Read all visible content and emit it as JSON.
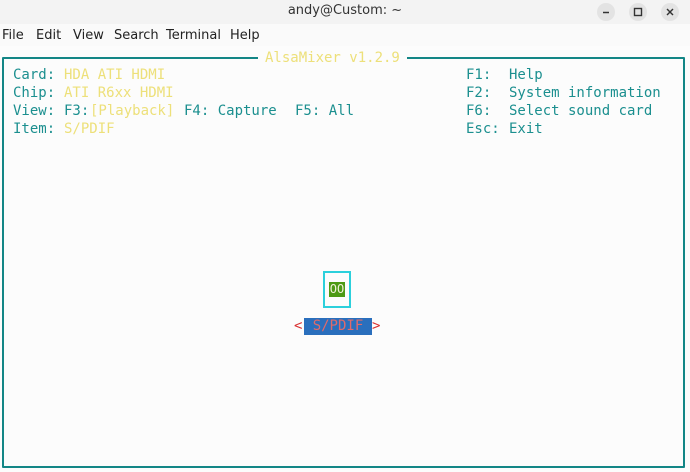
{
  "window": {
    "title": "andy@Custom: ~"
  },
  "menubar": {
    "items": [
      "File",
      "Edit",
      "View",
      "Search",
      "Terminal",
      "Help"
    ]
  },
  "mixer": {
    "title": "AlsaMixer v1.2.9",
    "card_label": "Card:",
    "card_value": "HDA ATI HDMI",
    "chip_label": "Chip:",
    "chip_value": "ATI R6xx HDMI",
    "view_label": "View:",
    "view_f3_key": "F3:",
    "view_f3_value": "[Playback]",
    "view_f4": "F4: Capture",
    "view_f5": "F5: All",
    "item_label": "Item:",
    "item_value": "S/PDIF",
    "help": [
      {
        "key": "F1:",
        "label": "Help"
      },
      {
        "key": "F2:",
        "label": "System information"
      },
      {
        "key": "F6:",
        "label": "Select sound card"
      },
      {
        "key": "Esc:",
        "label": "Exit"
      }
    ],
    "control": {
      "level": "OO",
      "name": "S/PDIF",
      "left_arrow": "<",
      "right_arrow": ">"
    }
  },
  "colors": {
    "frame": "#138686",
    "text": "#1b8f8f",
    "highlight": "#ede07a",
    "level_bg": "#4d9a14",
    "selected_bg": "#2a6fbd",
    "arrow": "#d92f2f"
  }
}
